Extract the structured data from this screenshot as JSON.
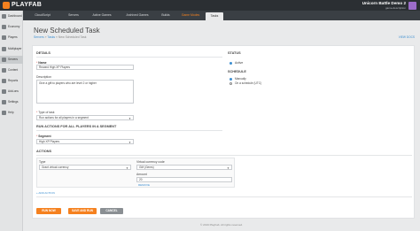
{
  "header": {
    "brand": "PLAYFAB",
    "game_title": "Unicorn Battle Demo 2",
    "game_subtitle": "game-description"
  },
  "sidebar": {
    "items": [
      {
        "label": "Dashboard",
        "icon": "dashboard-icon"
      },
      {
        "label": "Economy",
        "icon": "economy-icon"
      },
      {
        "label": "Players",
        "icon": "players-icon"
      },
      {
        "label": "Multiplayer",
        "icon": "multiplayer-icon"
      },
      {
        "label": "Servers",
        "icon": "servers-icon"
      },
      {
        "label": "Content",
        "icon": "content-icon"
      },
      {
        "label": "Reports",
        "icon": "reports-icon"
      },
      {
        "label": "Add-ons",
        "icon": "addons-icon"
      },
      {
        "label": "Settings",
        "icon": "settings-icon"
      },
      {
        "label": "Help",
        "icon": "help-icon"
      }
    ]
  },
  "tabs": [
    "CloudScript",
    "Servers",
    "Active Games",
    "Archived Games",
    "Builds",
    "Game Modes",
    "Tasks"
  ],
  "page": {
    "title": "New Scheduled Task",
    "breadcrumb": [
      "Servers",
      "Tasks",
      "New Scheduled Task"
    ],
    "help_link": "VIEW DOCS"
  },
  "details": {
    "heading": "DETAILS",
    "name_label": "Name",
    "name_value": "Reward High XP Players",
    "description_label": "Description",
    "description_value": "Give a gift to players who are level 2 or higher",
    "type_label": "Type of task",
    "type_value": "Run actions for all players in a segment"
  },
  "segment": {
    "heading": "RUN ACTIONS FOR ALL PLAYERS IN A SEGMENT",
    "label": "Segment",
    "value": "High XP Players"
  },
  "actions": {
    "heading": "ACTIONS",
    "type_label": "Type",
    "type_value": "Grant virtual currency",
    "currency_label": "Virtual currency code",
    "currency_value": "GM (Gems)",
    "amount_label": "Amount",
    "amount_value": "20",
    "remove_label": "REMOVE",
    "add_action": "ADD ACTION"
  },
  "status": {
    "heading": "STATUS",
    "value": "Active"
  },
  "schedule": {
    "heading": "SCHEDULE",
    "options": [
      "Manually",
      "On a schedule (UTC)"
    ]
  },
  "buttons": {
    "run_now": "RUN NOW",
    "save_run": "SAVE AND RUN",
    "cancel": "CANCEL"
  },
  "footer": "© 2019 PlayFab. All rights reserved.",
  "colors": {
    "accent": "#f5811f",
    "link": "#3b8ed0",
    "topbar": "#2b2f33"
  }
}
